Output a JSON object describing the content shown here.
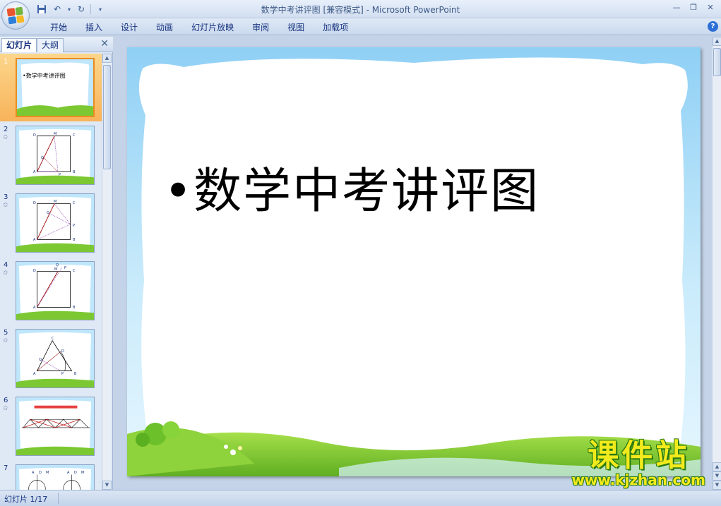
{
  "window": {
    "title": "数学中考讲评图 [兼容模式] - Microsoft PowerPoint"
  },
  "ribbon": {
    "tabs": [
      "开始",
      "插入",
      "设计",
      "动画",
      "幻灯片放映",
      "审阅",
      "视图",
      "加载项"
    ]
  },
  "panel": {
    "tab_slides": "幻灯片",
    "tab_outline": "大纲",
    "selected_slide": 1,
    "slides": [
      {
        "number": "1",
        "text": "•数学中考讲评图"
      },
      {
        "number": "2",
        "labels": [
          "D",
          "M",
          "C",
          "Q",
          "A",
          "P",
          "B"
        ]
      },
      {
        "number": "3",
        "labels": [
          "D",
          "M",
          "C",
          "Q",
          "P",
          "A",
          "B"
        ]
      },
      {
        "number": "4",
        "labels": [
          "Q",
          "P",
          "D",
          "M",
          "C",
          "A",
          "B"
        ]
      },
      {
        "number": "5",
        "labels": [
          "C",
          "Q",
          "D",
          "A",
          "P",
          "B"
        ]
      },
      {
        "number": "6",
        "text": ""
      },
      {
        "number": "7",
        "labels": [
          "A",
          "D",
          "M",
          "A",
          "D",
          "M"
        ]
      }
    ]
  },
  "slide": {
    "text": "•数学中考讲评图"
  },
  "status": {
    "slide_counter": "幻灯片 1/17"
  },
  "watermark": {
    "main": "课件站",
    "url": "www.kjzhan.com"
  },
  "colors": {
    "sky_top": "#8fd0f5",
    "sky_bottom": "#d8f1ff",
    "grass": "#7cc832",
    "selection": "#f8b35a"
  }
}
